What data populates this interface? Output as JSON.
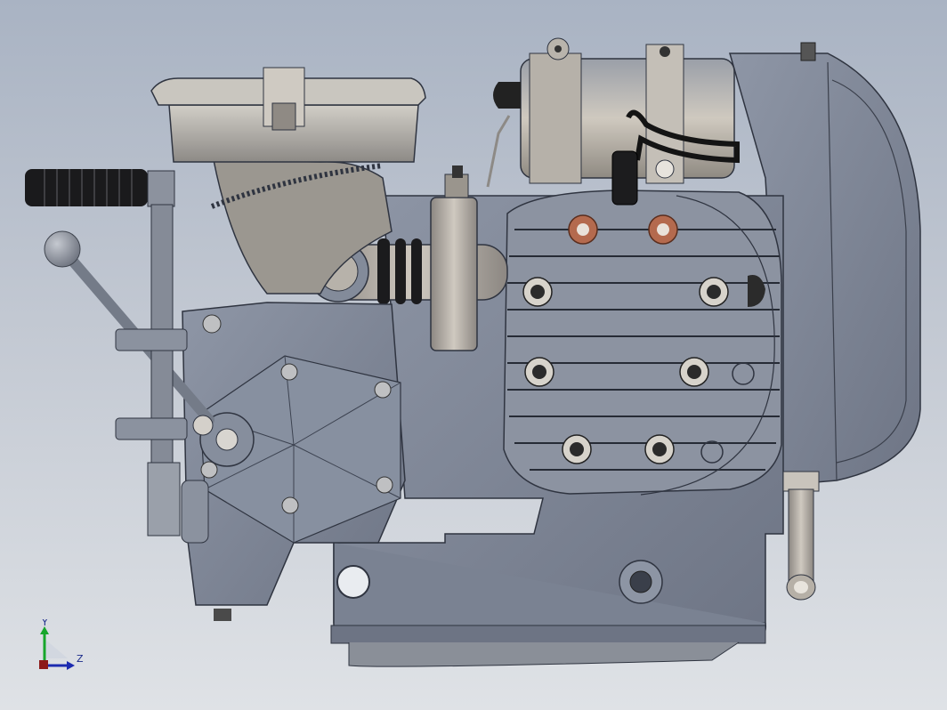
{
  "viewport": {
    "background_top": "#a9b3c3",
    "background_bottom": "#dfe2e6"
  },
  "model": {
    "body_color": "#7f8798",
    "chrome_color": "#b4aea4",
    "copper_color": "#b46a4e",
    "rubber_color": "#1b1b1d"
  },
  "triad": {
    "y_label": "Y",
    "z_label": "Z",
    "y_color": "#17a62b",
    "z_color": "#1c2bb0"
  }
}
